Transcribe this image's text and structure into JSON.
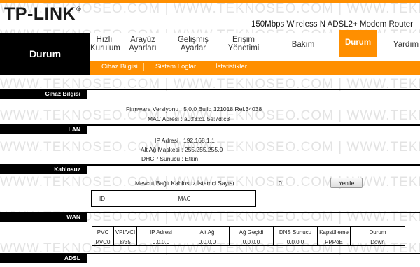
{
  "brand": {
    "logo_text": "TP-LINK",
    "logo_mark": "®",
    "model": "150Mbps Wireless N ADSL2+ Modem Router"
  },
  "page_title": "Durum",
  "nav": [
    {
      "line1": "Hızlı",
      "line2": "Kurulum"
    },
    {
      "line1": "Arayüz",
      "line2": "Ayarları"
    },
    {
      "line1": "Gelişmiş",
      "line2": "Ayarlar"
    },
    {
      "line1": "Erişim",
      "line2": "Yönetimi"
    },
    {
      "line1": "Bakım",
      "line2": ""
    },
    {
      "line1": "Durum",
      "line2": ""
    },
    {
      "line1": "Yardım",
      "line2": ""
    }
  ],
  "subnav": [
    "Cihaz Bilgisi",
    "Sistem Logları",
    "İstatistikler"
  ],
  "sections": {
    "device": "Cihaz Bilgisi",
    "lan": "LAN",
    "wireless": "Kablosuz",
    "wan": "WAN",
    "adsl": "ADSL"
  },
  "device": {
    "firmware_label": "Firmware Versiyonu :",
    "firmware_value": "5.0.0 Build 121018 Rel.34038",
    "mac_label": "MAC Adresi :",
    "mac_value": "a0:f3:c1:5e:7d:c3"
  },
  "lan": {
    "ip_label": "IP Adresi :",
    "ip_value": "192.168.1.1",
    "mask_label": "Alt Ağ Maskesi :",
    "mask_value": "255.255.255.0",
    "dhcp_label": "DHCP Sunucu :",
    "dhcp_value": "Etkin"
  },
  "wireless": {
    "clients_label": "Mevcut Bağlı Kablosuz İstemci Sayısı",
    "clients_value": "0",
    "refresh_button": "Yenile",
    "table_headers": [
      "ID",
      "MAC"
    ]
  },
  "wan": {
    "headers": [
      "PVC",
      "VPI/VCI",
      "IP Adresi",
      "Alt Ağ",
      "Ağ Geçidi",
      "DNS Sunucu",
      "Kapsülleme",
      "Durum"
    ],
    "rows": [
      [
        "PVC0",
        "8/35",
        "0.0.0.0",
        "0.0.0.0",
        "0.0.0.0",
        "0.0.0.0",
        "PPPoE",
        "Down"
      ]
    ]
  },
  "watermark": "WWW.TEKNOSEO.COM | WWW.TEKNOSEO.COM | WWW.TEKNOSEO.COM | WWW.TEKNOSEO.COM",
  "colors": {
    "accent": "#ff8f00",
    "bar": "#000000"
  }
}
